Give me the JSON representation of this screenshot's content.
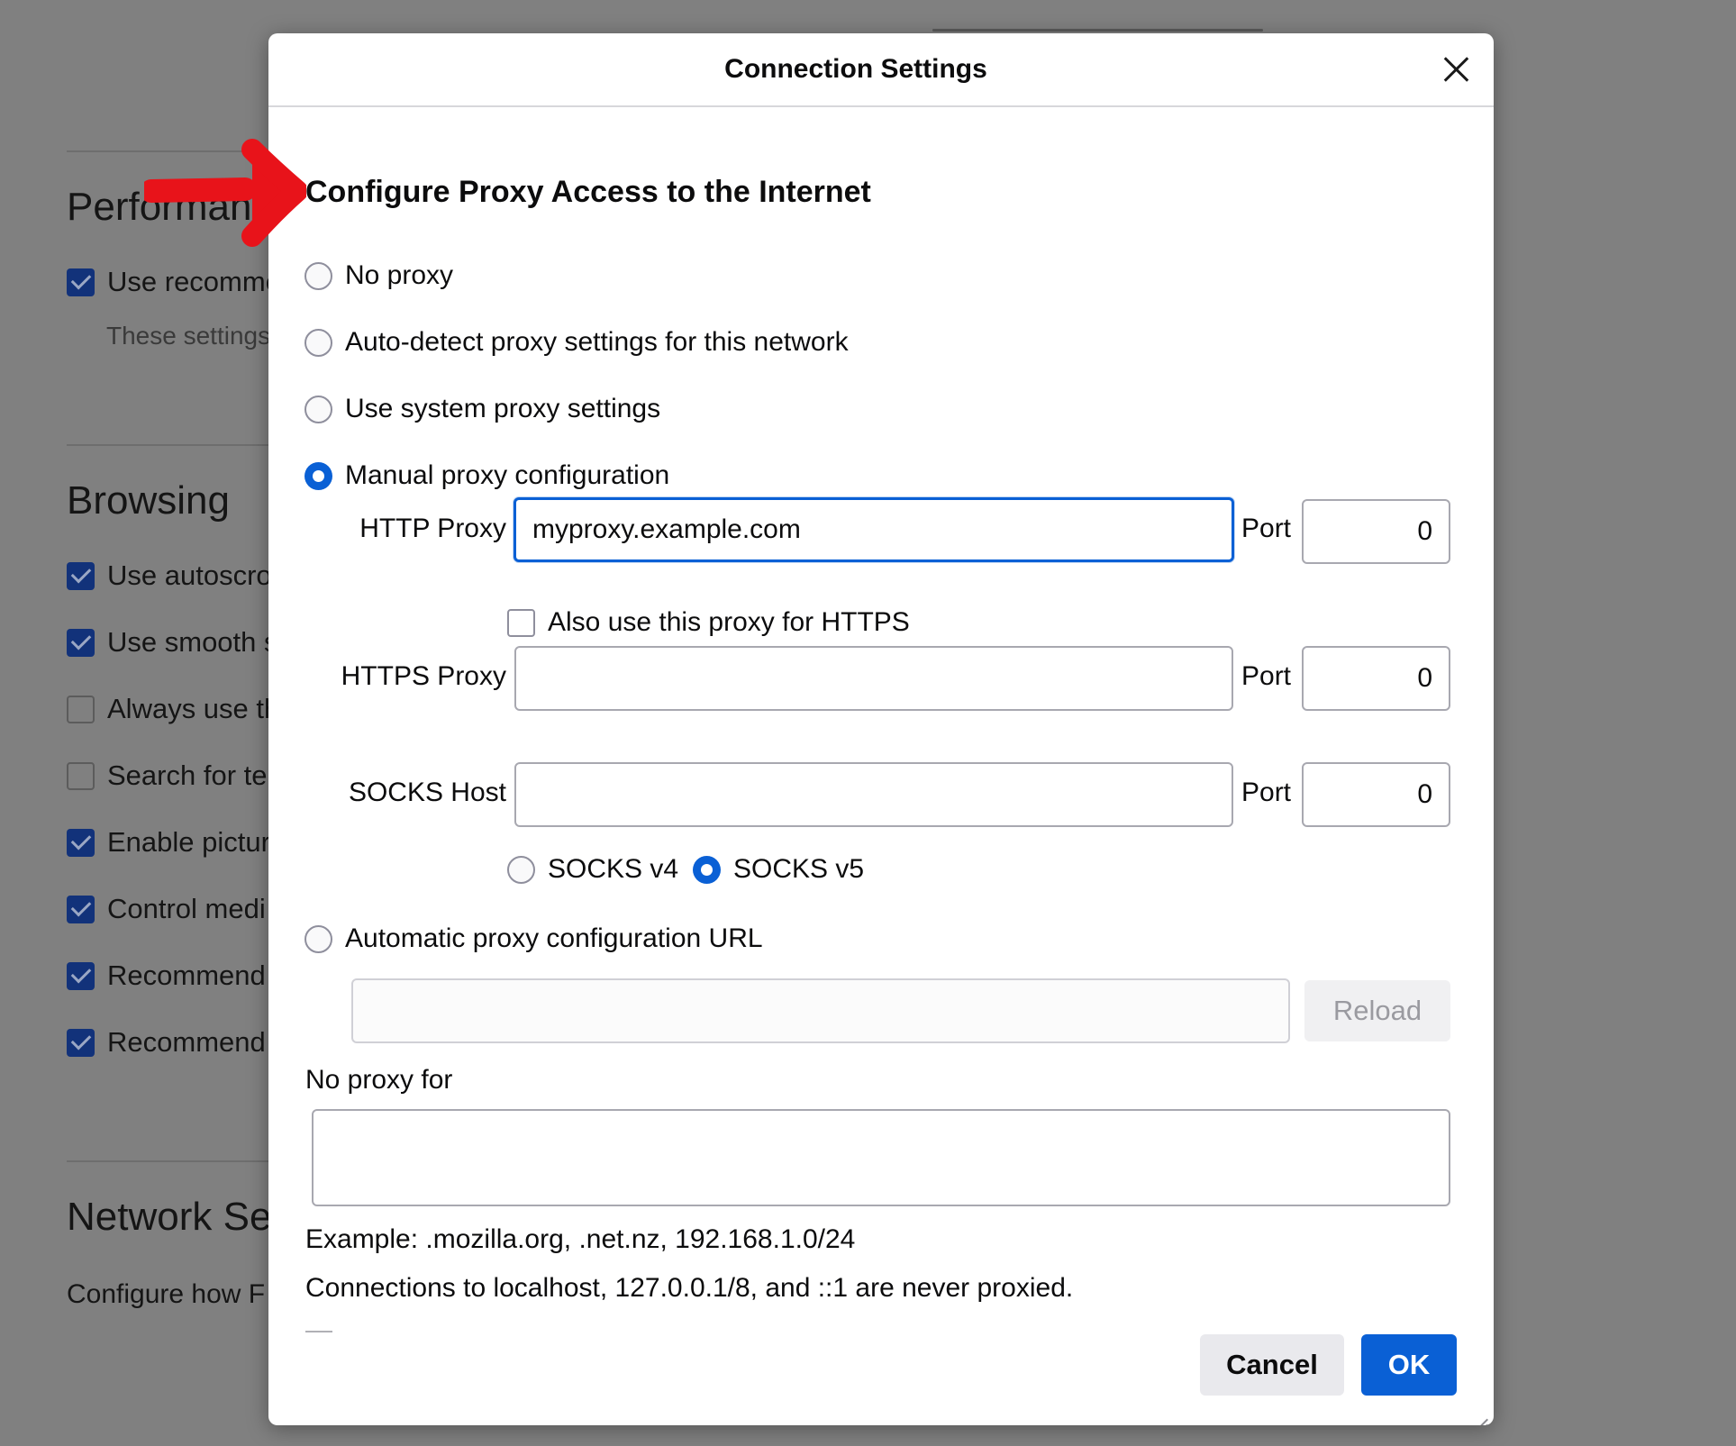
{
  "background": {
    "sections": [
      {
        "heading": "Performan"
      },
      {
        "heading": "Browsing"
      },
      {
        "heading": "Network Set"
      }
    ],
    "performance_items": [
      {
        "label": "Use recomme",
        "checked": true
      }
    ],
    "performance_note": "These settings",
    "browsing_items": [
      {
        "label": "Use autoscro",
        "checked": true
      },
      {
        "label": "Use smooth s",
        "checked": true
      },
      {
        "label": "Always use th",
        "checked": false
      },
      {
        "label": "Search for te",
        "checked": false
      },
      {
        "label": "Enable pictur",
        "checked": true
      },
      {
        "label": "Control medi",
        "checked": true
      },
      {
        "label": "Recommend",
        "checked": true
      },
      {
        "label": "Recommend",
        "checked": true
      }
    ],
    "network_note": "Configure how F"
  },
  "dialog": {
    "title": "Connection Settings",
    "section_title": "Configure Proxy Access to the Internet",
    "proxy_options": [
      {
        "label": "No proxy",
        "selected": false
      },
      {
        "label": "Auto-detect proxy settings for this network",
        "selected": false
      },
      {
        "label": "Use system proxy settings",
        "selected": false
      },
      {
        "label": "Manual proxy configuration",
        "selected": true
      }
    ],
    "http_proxy": {
      "label": "HTTP Proxy",
      "value": "myproxy.example.com",
      "port_label": "Port",
      "port": "0"
    },
    "also_https": {
      "label": "Also use this proxy for HTTPS",
      "checked": false
    },
    "https_proxy": {
      "label": "HTTPS Proxy",
      "value": "",
      "port_label": "Port",
      "port": "0"
    },
    "socks_host": {
      "label": "SOCKS Host",
      "value": "",
      "port_label": "Port",
      "port": "0"
    },
    "socks_versions": [
      {
        "label": "SOCKS v4",
        "selected": false
      },
      {
        "label": "SOCKS v5",
        "selected": true
      }
    ],
    "auto_config": {
      "label": "Automatic proxy configuration URL",
      "selected": false,
      "value": "",
      "reload_label": "Reload"
    },
    "no_proxy_for": {
      "label": "No proxy for",
      "value": ""
    },
    "example_text": "Example: .mozilla.org, .net.nz, 192.168.1.0/24",
    "localhost_text": "Connections to localhost, 127.0.0.1/8, and ::1 are never proxied.",
    "cancel_label": "Cancel",
    "ok_label": "OK"
  },
  "annotation": {
    "arrow_color": "#e8131a"
  },
  "colors": {
    "accent": "#0a60d5"
  }
}
